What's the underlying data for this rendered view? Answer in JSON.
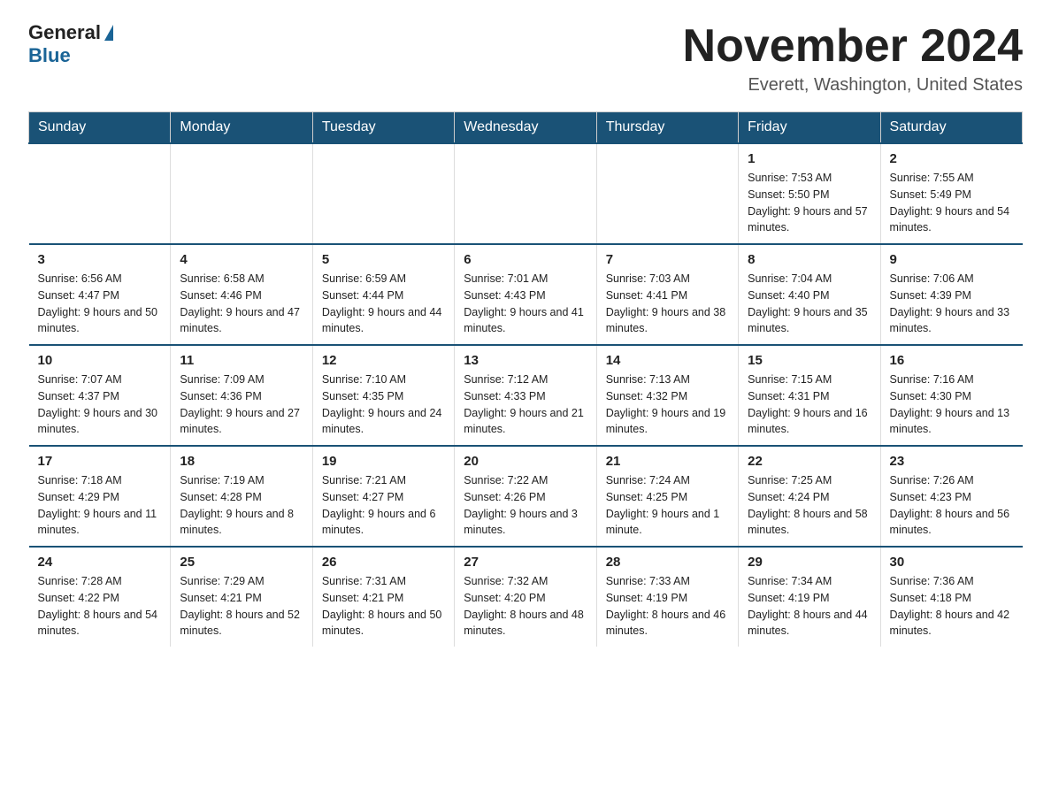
{
  "header": {
    "logo_general": "General",
    "logo_blue": "Blue",
    "title": "November 2024",
    "subtitle": "Everett, Washington, United States"
  },
  "weekdays": [
    "Sunday",
    "Monday",
    "Tuesday",
    "Wednesday",
    "Thursday",
    "Friday",
    "Saturday"
  ],
  "weeks": [
    [
      {
        "day": "",
        "info": ""
      },
      {
        "day": "",
        "info": ""
      },
      {
        "day": "",
        "info": ""
      },
      {
        "day": "",
        "info": ""
      },
      {
        "day": "",
        "info": ""
      },
      {
        "day": "1",
        "info": "Sunrise: 7:53 AM\nSunset: 5:50 PM\nDaylight: 9 hours\nand 57 minutes."
      },
      {
        "day": "2",
        "info": "Sunrise: 7:55 AM\nSunset: 5:49 PM\nDaylight: 9 hours\nand 54 minutes."
      }
    ],
    [
      {
        "day": "3",
        "info": "Sunrise: 6:56 AM\nSunset: 4:47 PM\nDaylight: 9 hours\nand 50 minutes."
      },
      {
        "day": "4",
        "info": "Sunrise: 6:58 AM\nSunset: 4:46 PM\nDaylight: 9 hours\nand 47 minutes."
      },
      {
        "day": "5",
        "info": "Sunrise: 6:59 AM\nSunset: 4:44 PM\nDaylight: 9 hours\nand 44 minutes."
      },
      {
        "day": "6",
        "info": "Sunrise: 7:01 AM\nSunset: 4:43 PM\nDaylight: 9 hours\nand 41 minutes."
      },
      {
        "day": "7",
        "info": "Sunrise: 7:03 AM\nSunset: 4:41 PM\nDaylight: 9 hours\nand 38 minutes."
      },
      {
        "day": "8",
        "info": "Sunrise: 7:04 AM\nSunset: 4:40 PM\nDaylight: 9 hours\nand 35 minutes."
      },
      {
        "day": "9",
        "info": "Sunrise: 7:06 AM\nSunset: 4:39 PM\nDaylight: 9 hours\nand 33 minutes."
      }
    ],
    [
      {
        "day": "10",
        "info": "Sunrise: 7:07 AM\nSunset: 4:37 PM\nDaylight: 9 hours\nand 30 minutes."
      },
      {
        "day": "11",
        "info": "Sunrise: 7:09 AM\nSunset: 4:36 PM\nDaylight: 9 hours\nand 27 minutes."
      },
      {
        "day": "12",
        "info": "Sunrise: 7:10 AM\nSunset: 4:35 PM\nDaylight: 9 hours\nand 24 minutes."
      },
      {
        "day": "13",
        "info": "Sunrise: 7:12 AM\nSunset: 4:33 PM\nDaylight: 9 hours\nand 21 minutes."
      },
      {
        "day": "14",
        "info": "Sunrise: 7:13 AM\nSunset: 4:32 PM\nDaylight: 9 hours\nand 19 minutes."
      },
      {
        "day": "15",
        "info": "Sunrise: 7:15 AM\nSunset: 4:31 PM\nDaylight: 9 hours\nand 16 minutes."
      },
      {
        "day": "16",
        "info": "Sunrise: 7:16 AM\nSunset: 4:30 PM\nDaylight: 9 hours\nand 13 minutes."
      }
    ],
    [
      {
        "day": "17",
        "info": "Sunrise: 7:18 AM\nSunset: 4:29 PM\nDaylight: 9 hours\nand 11 minutes."
      },
      {
        "day": "18",
        "info": "Sunrise: 7:19 AM\nSunset: 4:28 PM\nDaylight: 9 hours\nand 8 minutes."
      },
      {
        "day": "19",
        "info": "Sunrise: 7:21 AM\nSunset: 4:27 PM\nDaylight: 9 hours\nand 6 minutes."
      },
      {
        "day": "20",
        "info": "Sunrise: 7:22 AM\nSunset: 4:26 PM\nDaylight: 9 hours\nand 3 minutes."
      },
      {
        "day": "21",
        "info": "Sunrise: 7:24 AM\nSunset: 4:25 PM\nDaylight: 9 hours\nand 1 minute."
      },
      {
        "day": "22",
        "info": "Sunrise: 7:25 AM\nSunset: 4:24 PM\nDaylight: 8 hours\nand 58 minutes."
      },
      {
        "day": "23",
        "info": "Sunrise: 7:26 AM\nSunset: 4:23 PM\nDaylight: 8 hours\nand 56 minutes."
      }
    ],
    [
      {
        "day": "24",
        "info": "Sunrise: 7:28 AM\nSunset: 4:22 PM\nDaylight: 8 hours\nand 54 minutes."
      },
      {
        "day": "25",
        "info": "Sunrise: 7:29 AM\nSunset: 4:21 PM\nDaylight: 8 hours\nand 52 minutes."
      },
      {
        "day": "26",
        "info": "Sunrise: 7:31 AM\nSunset: 4:21 PM\nDaylight: 8 hours\nand 50 minutes."
      },
      {
        "day": "27",
        "info": "Sunrise: 7:32 AM\nSunset: 4:20 PM\nDaylight: 8 hours\nand 48 minutes."
      },
      {
        "day": "28",
        "info": "Sunrise: 7:33 AM\nSunset: 4:19 PM\nDaylight: 8 hours\nand 46 minutes."
      },
      {
        "day": "29",
        "info": "Sunrise: 7:34 AM\nSunset: 4:19 PM\nDaylight: 8 hours\nand 44 minutes."
      },
      {
        "day": "30",
        "info": "Sunrise: 7:36 AM\nSunset: 4:18 PM\nDaylight: 8 hours\nand 42 minutes."
      }
    ]
  ]
}
